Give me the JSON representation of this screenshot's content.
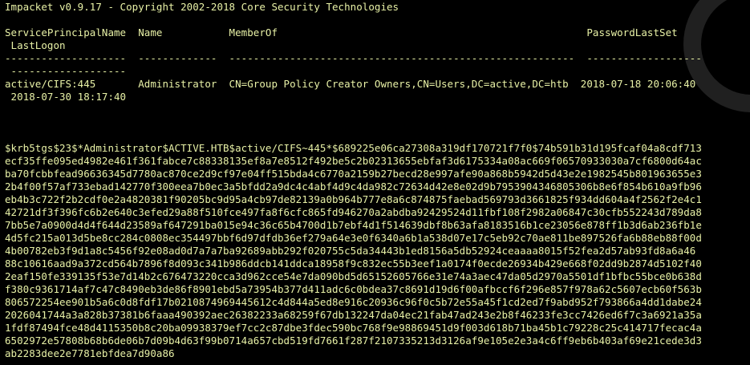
{
  "theme": {
    "background": "#000000",
    "text": "#e8f1a6",
    "decoration": "#202020"
  },
  "terminal": {
    "banner": "Impacket v0.9.17 - Copyright 2002-2018 Core Security Technologies",
    "table": {
      "header_line1": "ServicePrincipalName  Name           MemberOf                                                   PasswordLastSet",
      "header_line2": " LastLogon",
      "separator_line1": "--------------------  -------------  ---------------------------------------------------------  -------------------",
      "separator_line2": " -------------------",
      "row_line1": "active/CIFS:445       Administrator  CN=Group Policy Creator Owners,CN=Users,DC=active,DC=htb  2018-07-18 20:06:40",
      "row_line2": " 2018-07-30 18:17:40"
    },
    "hash_lines": [
      "$krb5tgs$23$*Administrator$ACTIVE.HTB$active/CIFS~445*$689225e06ca27308a319df170721f7f0$74b591b31d195fcaf04a8cdf713",
      "ecf35ffe095ed4982e461f361fabce7c88338135ef8a7e8512f492be5c2b02313655ebfaf3d6175334a08ac669f06570933030a7cf6800d64ac",
      "ba70fcbbfead96636345d7780ac870ce2d9cf97e04ff515bda4c6770a2159b27becd28e997afe90a868b5942d5d43e2e1982545b801963655e3",
      "2b4f00f57af733ebad142770f300eea7b0ec3a5bfdd2a9dc4c4abf4d9c4da982c72634d42e8e02d9b7953904346805306b8e6f854b610a9fb96",
      "eb4b3c722f2b2cdf0e2a4820381f90205bc9d95a4cb97de82139a0b964b777e8a6c874875faebad569793d3661825f934dd604a4f2562f2e4c1",
      "42721df3f396fc6b2e640c3efed29a88f510fce497fa8f6cfc865fd946270a2abdba92429524d11fbf108f2982a06847c30cfb552243d789da8",
      "7bb5e7a0900d4d4f644d23589af647291ba015e94c36c65b4700d1b7ebf4d1f514639dbf8b63afa8183516b1ce23056e878ff1b3d6ab236fb1e",
      "4d5fc215a013d5be8cc284c0808ec354497bbf6d97dfdb36ef279a64e3e0f6340a6b1a538d07e17c5eb92c70ae811be897526fa6b88eb88f00d",
      "4b00782eb3f9d1a8c5456f92e08ad0d7a7a7ba92689abb292f020755c5da34443b1ed8156a5db52924ceaaaa8015f52fea2d57ab93fd8a6a46",
      "88c10616aad9a372cd564b7896f8d093c341b986ddcb141ddca18958f9c832ec55b3eef1a0174f0ecde26934b429e668f02dd9b2874d5102f40",
      "2eaf150fe339135f53e7d14b2c676473220cca3d962cce54e7da090bd5d65152605766e31e74a3aec47da05d2970a5501df1bfbc55bce0b638d",
      "f380c9361714af7c47c8490eb3de86f8901ebd5a73954b377d411adc6c0bdea37c8691d19d6f00afbccf6f296e857f978a62c5607ecb60f563b",
      "806572254ee901b5a6c0d8fdf17b0210874969445612c4d844a5ed8e916c20936c96f0c5b72e55a45f1cd2ed7f9abd952f793866a4dd1dabe24",
      "2026041744a3a828b37381b6faaa490392aec26382233a68259f67db132247da04ec21fab47ad243e2b8f46233fe3cc7426ed6f7c3a6921a35a",
      "1fdf87494fce48d4115350b8c20ba09938379ef7cc2c87dbe3fdec590bc768f9e98869451d9f003d618b71ba45b1c79228c25c414717fecac4a",
      "6502972e57808b68b6de06b7d09b4d63f99b0714a657cbd519fd7661f287f2107335213d3126af9e105e2e3a4c6ff9eb6b403af69e21cede3d3",
      "ab2283dee2e7781ebfdea7d90a86"
    ]
  }
}
